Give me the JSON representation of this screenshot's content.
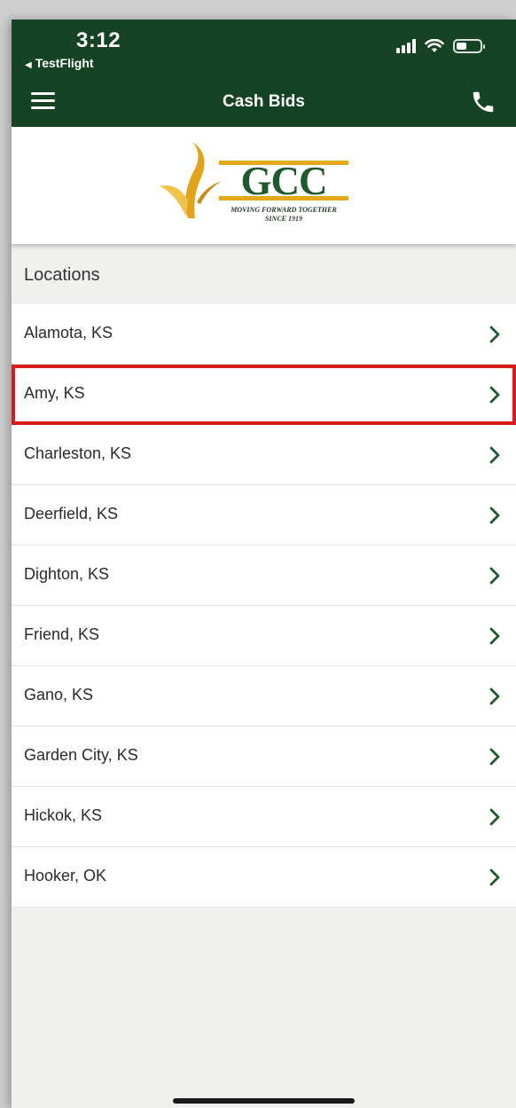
{
  "status_bar": {
    "time": "3:12",
    "back_app": "TestFlight",
    "back_arrow_icon": "back-triangle-icon",
    "battery_level": 0.45
  },
  "nav": {
    "title": "Cash Bids",
    "menu_icon": "hamburger-menu-icon",
    "phone_icon": "phone-icon"
  },
  "logo": {
    "text": "GCC",
    "tagline_line1": "MOVING FORWARD TOGETHER",
    "tagline_line2": "SINCE 1919"
  },
  "locations": {
    "header": "Locations",
    "items": [
      {
        "label": "Alamota, KS"
      },
      {
        "label": "Amy, KS"
      },
      {
        "label": "Charleston, KS"
      },
      {
        "label": "Deerfield, KS"
      },
      {
        "label": "Dighton, KS"
      },
      {
        "label": "Friend, KS"
      },
      {
        "label": "Gano, KS"
      },
      {
        "label": "Garden City, KS"
      },
      {
        "label": "Hickok, KS"
      },
      {
        "label": "Hooker, OK"
      }
    ],
    "highlighted_index": 1
  },
  "colors": {
    "brand_green": "#154324",
    "logo_gold": "#e3a81b",
    "chevron": "#1e5a2c",
    "highlight_red": "#d81a1a"
  }
}
